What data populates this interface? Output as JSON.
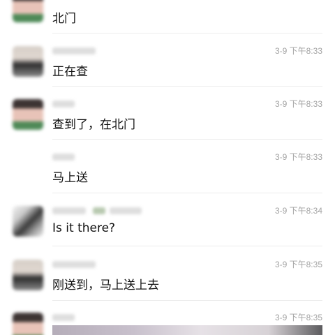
{
  "messages": [
    {
      "text": "北门",
      "time": ""
    },
    {
      "text": "正在查",
      "time": "3-9 下午8:33"
    },
    {
      "text": "查到了，在北门",
      "time": "3-9 下午8:33"
    },
    {
      "text": "马上送",
      "time": "3-9 下午8:33"
    },
    {
      "text": "Is it there?",
      "time": "3-9 下午8:34"
    },
    {
      "text": "刚送到，马上送上去",
      "time": "3-9 下午8:35"
    },
    {
      "text": "",
      "time": "3-9 下午8:35"
    }
  ],
  "avatars": [
    {
      "icon": "avatar-person",
      "colors": [
        "#3d3433",
        "#e8c3b8",
        "#4f8a58"
      ]
    },
    {
      "icon": "avatar-person",
      "colors": [
        "#2c2c2c",
        "#e0d7d0",
        "#8a8a8a"
      ]
    },
    {
      "icon": "avatar-person",
      "colors": [
        "#3d3433",
        "#e8c3b8",
        "#4f8a58"
      ]
    },
    {
      "icon": "avatar-person",
      "colors": [
        "#3a3a3a",
        "#c9c9c9",
        "#f2f2f2"
      ]
    },
    {
      "icon": "avatar-person",
      "colors": [
        "#2c2c2c",
        "#e0d7d0",
        "#8a8a8a"
      ]
    },
    {
      "icon": "avatar-person",
      "colors": [
        "#3d3433",
        "#e8c3b8",
        "#4f8a58"
      ]
    }
  ],
  "colors": {
    "text": "#111111",
    "time": "#a3a3a3",
    "divider": "#ececec"
  }
}
